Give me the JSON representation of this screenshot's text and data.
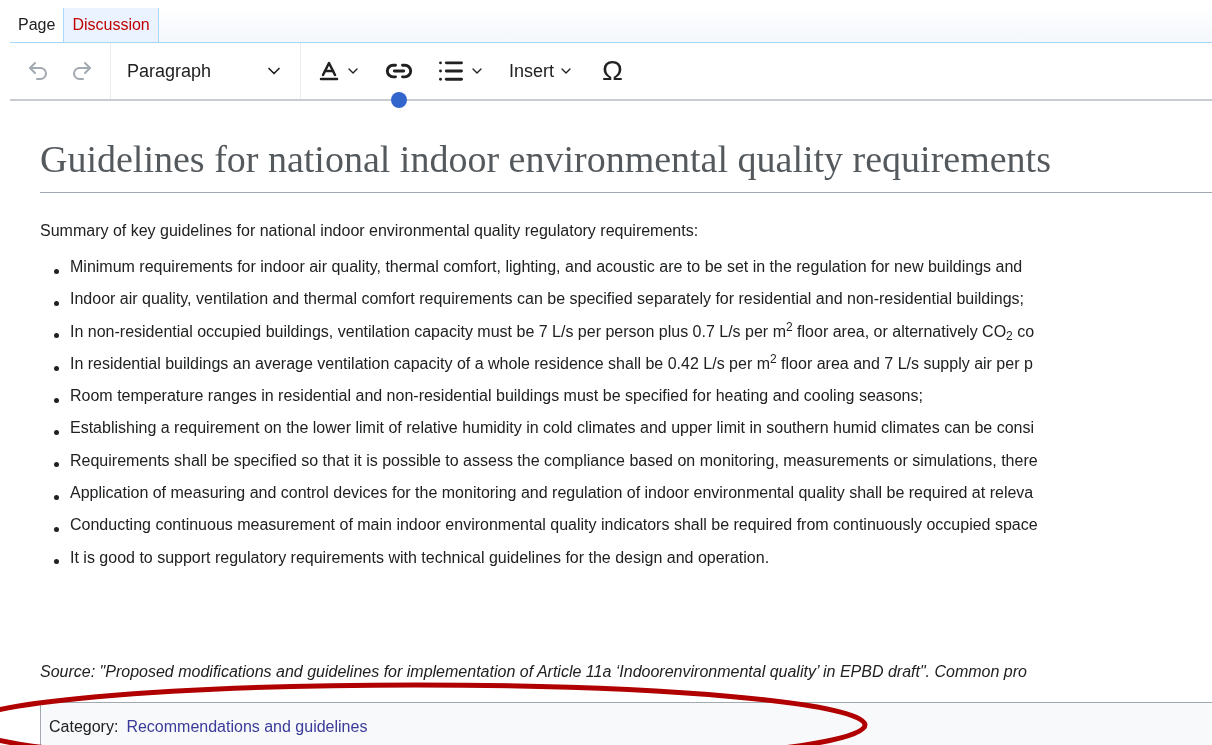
{
  "tabs": [
    {
      "label": "Page",
      "selected": true
    },
    {
      "label": "Discussion",
      "selected": false
    }
  ],
  "toolbar": {
    "format": "Paragraph",
    "insert": "Insert",
    "special": "Ω"
  },
  "title": "Guidelines for national indoor environmental quality requirements",
  "intro": "Summary of key guidelines for national indoor environmental quality regulatory requirements:",
  "bullets": [
    "Minimum requirements for indoor air quality, thermal comfort, lighting, and acoustic are to be set in the regulation for new buildings and",
    "Indoor air quality, ventilation and thermal comfort requirements can be specified separately for residential and non-residential buildings;",
    "In non-residential occupied buildings, ventilation capacity must be 7 L/s per person plus 0.7 L/s per m$^{2}$ floor area, or alternatively CO$_{2}$ co",
    "In residential buildings an average ventilation capacity of a whole residence shall be 0.42 L/s per m$^{2}$ floor area and 7 L/s supply air per p",
    "Room temperature ranges in residential and non-residential buildings must be specified for heating and cooling seasons;",
    "Establishing a requirement on the lower limit of relative humidity in cold climates and upper limit in southern humid climates can be consi",
    "Requirements shall be specified so that it is possible to assess the compliance based on monitoring, measurements or simulations, there",
    "Application of measuring and control devices for the monitoring and regulation of indoor environmental quality shall be required at releva",
    "Conducting continuous measurement of main indoor environmental quality indicators shall be required from continuously occupied space",
    "It is good to support regulatory requirements with technical guidelines for the design and operation."
  ],
  "source": "Source: \"Proposed modifications and guidelines for implementation of Article 11a ‘Indoorenvironmental quality’ in EPBD draft\". Common pro",
  "category": {
    "label": "Category:",
    "link": "Recommendations and guidelines"
  }
}
